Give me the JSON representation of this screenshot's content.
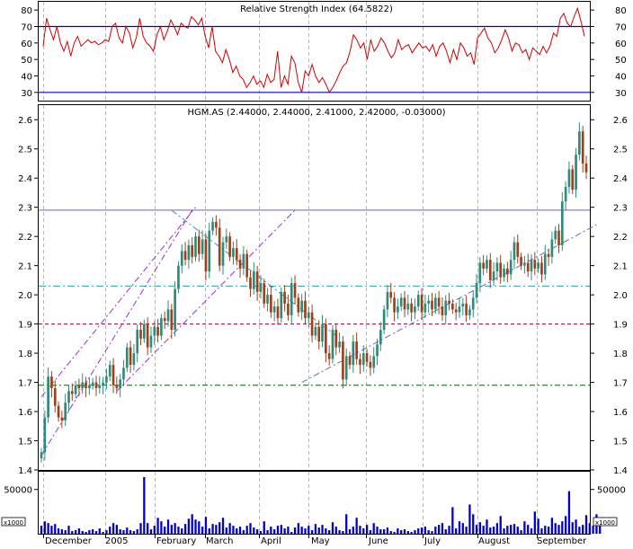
{
  "chart_data": [
    {
      "type": "line",
      "panel": "rsi",
      "title": "Relative Strength Index (64.5822)",
      "ylim": [
        25,
        85
      ],
      "yticks": [
        30,
        40,
        50,
        60,
        70,
        80
      ],
      "levels": [
        70,
        30
      ],
      "series": [
        {
          "values": [
            58,
            75,
            68,
            62,
            70,
            60,
            55,
            61,
            52,
            60,
            64,
            58,
            60,
            62,
            60,
            61,
            59,
            60,
            62,
            61,
            70,
            72,
            63,
            60,
            70,
            66,
            57,
            63,
            75,
            64,
            60,
            58,
            55,
            65,
            70,
            62,
            67,
            74,
            70,
            65,
            72,
            70,
            69,
            76,
            74,
            71,
            75,
            64,
            57,
            70,
            55,
            52,
            48,
            56,
            50,
            42,
            46,
            40,
            38,
            33,
            36,
            40,
            35,
            37,
            33,
            41,
            36,
            38,
            55,
            33,
            40,
            35,
            52,
            48,
            36,
            30,
            43,
            40,
            47,
            40,
            36,
            39,
            35,
            30,
            33,
            37,
            42,
            46,
            48,
            55,
            65,
            62,
            57,
            60,
            50,
            62,
            55,
            58,
            63,
            60,
            55,
            51,
            54,
            62,
            56,
            58,
            59,
            54,
            57,
            60,
            57,
            58,
            55,
            59,
            52,
            58,
            60,
            55,
            48,
            56,
            50,
            60,
            57,
            52,
            54,
            47,
            63,
            66,
            69,
            63,
            60,
            54,
            57,
            62,
            68,
            63,
            55,
            60,
            59,
            54,
            56,
            50,
            57,
            55,
            53,
            58,
            54,
            58,
            66,
            64,
            75,
            78,
            72,
            70,
            76,
            81,
            73,
            64
          ]
        }
      ]
    },
    {
      "type": "candlestick",
      "panel": "price",
      "title": "HGM.AS (2.44000, 2.44000, 2.41000, 2.42000, -0.03000)",
      "ylim": [
        1.4,
        2.65
      ],
      "yticks": [
        1.4,
        1.5,
        1.6,
        1.7,
        1.8,
        1.9,
        2.0,
        2.1,
        2.2,
        2.3,
        2.4,
        2.5,
        2.6
      ],
      "close": [
        1.46,
        1.58,
        1.72,
        1.68,
        1.62,
        1.58,
        1.57,
        1.63,
        1.67,
        1.66,
        1.69,
        1.68,
        1.7,
        1.68,
        1.69,
        1.7,
        1.68,
        1.69,
        1.7,
        1.72,
        1.76,
        1.69,
        1.68,
        1.71,
        1.75,
        1.82,
        1.76,
        1.8,
        1.88,
        1.85,
        1.9,
        1.82,
        1.86,
        1.89,
        1.86,
        1.92,
        1.91,
        1.95,
        1.88,
        2.02,
        2.1,
        2.15,
        2.12,
        2.17,
        2.13,
        2.2,
        2.14,
        2.19,
        2.08,
        2.22,
        2.25,
        2.23,
        2.1,
        2.18,
        2.2,
        2.13,
        2.16,
        2.12,
        2.09,
        2.14,
        2.06,
        2.02,
        2.08,
        2.01,
        2.04,
        1.97,
        2.0,
        1.94,
        1.96,
        1.92,
        2.01,
        1.97,
        1.93,
        2.04,
        1.99,
        1.94,
        1.98,
        1.92,
        1.94,
        1.86,
        1.89,
        1.84,
        1.9,
        1.8,
        1.78,
        1.88,
        1.82,
        1.84,
        1.71,
        1.79,
        1.76,
        1.84,
        1.78,
        1.76,
        1.8,
        1.77,
        1.75,
        1.79,
        1.83,
        1.88,
        1.95,
        2.01,
        1.99,
        1.94,
        1.96,
        1.99,
        1.95,
        1.97,
        1.94,
        1.96,
        2.0,
        1.94,
        1.97,
        1.98,
        1.95,
        1.99,
        1.96,
        1.93,
        1.98,
        1.97,
        1.95,
        1.94,
        1.96,
        1.97,
        1.93,
        1.95,
        1.99,
        2.04,
        2.11,
        2.09,
        2.12,
        2.05,
        2.08,
        2.11,
        2.06,
        2.09,
        2.07,
        2.12,
        2.18,
        2.13,
        2.1,
        2.11,
        2.08,
        2.12,
        2.09,
        2.11,
        2.07,
        2.14,
        2.13,
        2.19,
        2.22,
        2.17,
        2.32,
        2.37,
        2.43,
        2.36,
        2.48,
        2.56,
        2.45,
        2.42
      ]
    },
    {
      "type": "bar",
      "panel": "volume",
      "unit_label": "x1000",
      "ylim": [
        0,
        70000
      ],
      "yticks": [
        50000
      ],
      "values": [
        9000,
        14000,
        12000,
        9000,
        11000,
        6000,
        5000,
        4000,
        9000,
        3000,
        4000,
        6000,
        3000,
        2000,
        4000,
        5000,
        3000,
        6000,
        2000,
        4000,
        8000,
        12000,
        10000,
        5000,
        4000,
        7000,
        4000,
        3000,
        5000,
        12000,
        64000,
        12000,
        5000,
        9000,
        18000,
        14000,
        8000,
        16000,
        10000,
        12000,
        8000,
        6000,
        11000,
        17000,
        22000,
        16000,
        14000,
        8000,
        19000,
        6000,
        11000,
        10000,
        13000,
        18000,
        7000,
        12000,
        9000,
        6000,
        8000,
        4000,
        9000,
        12000,
        7000,
        5000,
        3000,
        14000,
        4000,
        8000,
        5000,
        9000,
        10000,
        6000,
        8000,
        2000,
        7000,
        12000,
        8000,
        6000,
        9000,
        4000,
        11000,
        7000,
        10000,
        6000,
        4000,
        13000,
        8000,
        4000,
        3000,
        22000,
        5000,
        8000,
        18000,
        9000,
        6000,
        10000,
        4000,
        12000,
        8000,
        5000,
        5000,
        7000,
        3000,
        2000,
        6000,
        4000,
        5000,
        3000,
        2000,
        4000,
        6000,
        7000,
        8000,
        4000,
        3000,
        8000,
        10000,
        12000,
        5000,
        9000,
        30000,
        6000,
        14000,
        12000,
        8000,
        33000,
        22000,
        10000,
        13000,
        9000,
        16000,
        7000,
        8000,
        12000,
        20000,
        6000,
        9000,
        10000,
        11000,
        8000,
        4000,
        14000,
        10000,
        6000,
        25000,
        17000,
        6000,
        9000,
        8000,
        18000,
        12000,
        10000,
        14000,
        20000,
        48000,
        13000,
        16000,
        8000,
        10000,
        21000,
        12000,
        9000,
        22000,
        13000
      ]
    }
  ],
  "x_axis": {
    "labels": [
      "December",
      "2005",
      "February",
      "March",
      "April",
      "May",
      "June",
      "July",
      "August",
      "September"
    ]
  },
  "colors": {
    "rsi_line": "#d40000",
    "level_line": "#0000cc",
    "candle_up": "#2e8b7a",
    "candle_down": "#a0401a",
    "volume": "#0000cc",
    "grid": "#b8b8b8",
    "trend_purple": "#9933cc",
    "trend_teal": "#2aa0a0",
    "trend_green": "#006600",
    "trend_maroon": "#800040",
    "trend_blue": "#6666cc"
  }
}
